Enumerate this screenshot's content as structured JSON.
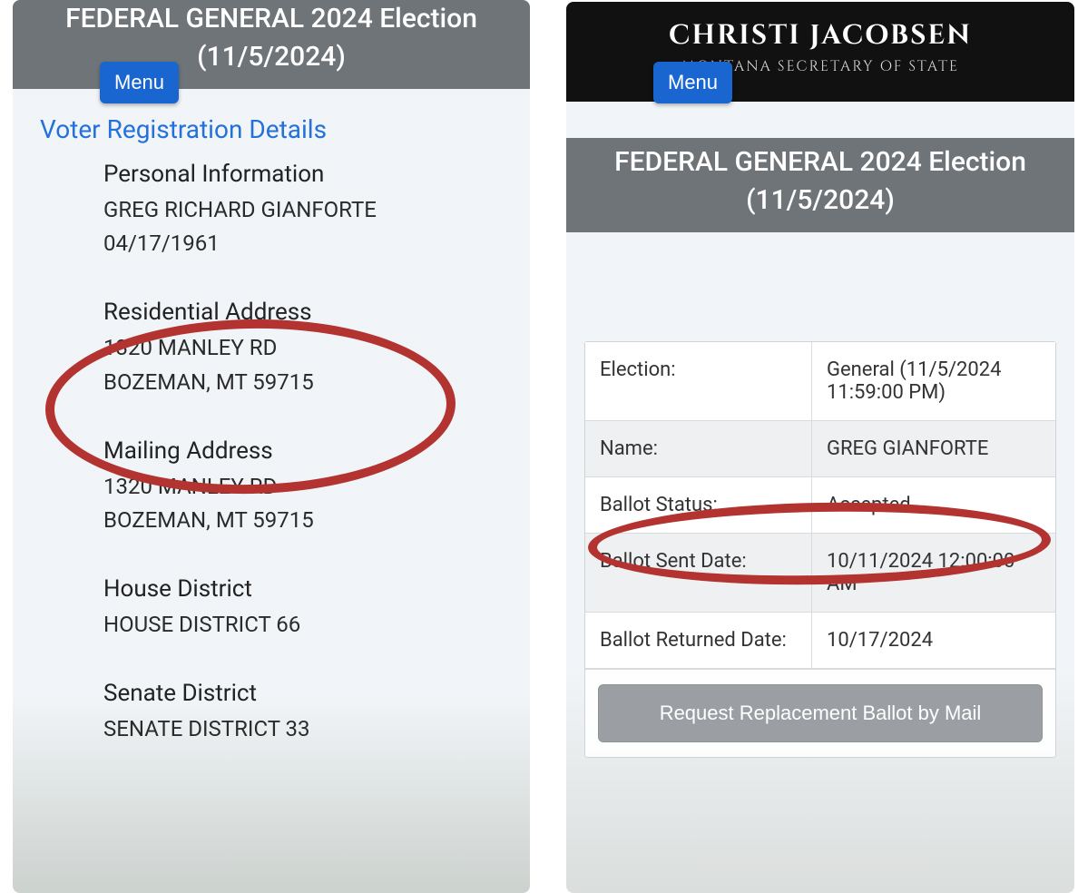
{
  "shared": {
    "menu_label": "Menu",
    "banner_title": "FEDERAL GENERAL 2024 Election",
    "banner_date": "(11/5/2024)"
  },
  "left": {
    "section_title": "Voter Registration Details",
    "personal": {
      "heading": "Personal Information",
      "name": "GREG RICHARD GIANFORTE",
      "dob": "04/17/1961"
    },
    "residential": {
      "heading": "Residential Address",
      "line1": "1320 MANLEY RD",
      "line2": "BOZEMAN, MT 59715"
    },
    "mailing": {
      "heading": "Mailing Address",
      "line1": "1320 MANLEY RD",
      "line2": "BOZEMAN, MT 59715"
    },
    "house": {
      "heading": "House District",
      "value": "HOUSE DISTRICT 66"
    },
    "senate": {
      "heading": "Senate District",
      "value": "SENATE DISTRICT 33"
    }
  },
  "right": {
    "brand_name": "CHRISTI JACOBSEN",
    "brand_sub": "MONTANA SECRETARY OF STATE",
    "rows": {
      "election": {
        "label": "Election:",
        "value": "General (11/5/2024 11:59:00 PM)"
      },
      "name": {
        "label": "Name:",
        "value": "GREG GIANFORTE"
      },
      "ballot_status": {
        "label": "Ballot Status:",
        "value": "Accepted"
      },
      "ballot_sent": {
        "label": "Ballot Sent Date:",
        "value": "10/11/2024 12:00:00 AM"
      },
      "ballot_returned": {
        "label": "Ballot Returned Date:",
        "value": "10/17/2024"
      }
    },
    "replace_button": "Request Replacement Ballot by Mail"
  },
  "colors": {
    "accent_blue": "#1a66d0",
    "banner_gray": "#6f7478",
    "annotation_red": "#b23330"
  }
}
